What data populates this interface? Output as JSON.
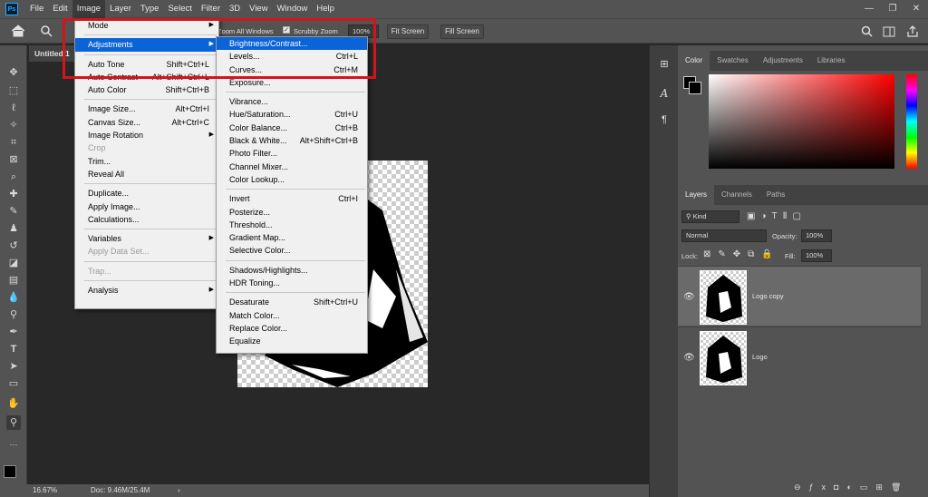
{
  "app": {
    "logo": "Ps"
  },
  "menubar": {
    "items": [
      "File",
      "Edit",
      "Image",
      "Layer",
      "Type",
      "Select",
      "Filter",
      "3D",
      "View",
      "Window",
      "Help"
    ]
  },
  "window_controls": {
    "minimize": "—",
    "restore": "❐",
    "close": "✕"
  },
  "options": {
    "zoom_all_windows": "Zoom All Windows",
    "scrubby_zoom": "Scrubby Zoom",
    "zoom_value": "100%",
    "fit_screen": "Fit Screen",
    "fill_screen": "Fill Screen"
  },
  "document": {
    "tab_title": "Untitled 1"
  },
  "status": {
    "zoom": "16.67%",
    "doc_size": "Doc: 9.46M/25.4M",
    "arrow": "›"
  },
  "image_menu": {
    "mode": "Mode",
    "adjustments": "Adjustments",
    "auto_tone": "Auto Tone",
    "auto_tone_sc": "Shift+Ctrl+L",
    "auto_contrast": "Auto Contrast",
    "auto_contrast_sc": "Alt+Shift+Ctrl+L",
    "auto_color": "Auto Color",
    "auto_color_sc": "Shift+Ctrl+B",
    "image_size": "Image Size...",
    "image_size_sc": "Alt+Ctrl+I",
    "canvas_size": "Canvas Size...",
    "canvas_size_sc": "Alt+Ctrl+C",
    "image_rotation": "Image Rotation",
    "crop": "Crop",
    "trim": "Trim...",
    "reveal_all": "Reveal All",
    "duplicate": "Duplicate...",
    "apply_image": "Apply Image...",
    "calculations": "Calculations...",
    "variables": "Variables",
    "apply_data_set": "Apply Data Set...",
    "trap": "Trap...",
    "analysis": "Analysis"
  },
  "adjustments_menu": {
    "brightness_contrast": "Brightness/Contrast...",
    "levels": "Levels...",
    "levels_sc": "Ctrl+L",
    "curves": "Curves...",
    "curves_sc": "Ctrl+M",
    "exposure": "Exposure...",
    "vibrance": "Vibrance...",
    "hue_saturation": "Hue/Saturation...",
    "hue_saturation_sc": "Ctrl+U",
    "color_balance": "Color Balance...",
    "color_balance_sc": "Ctrl+B",
    "black_white": "Black & White...",
    "black_white_sc": "Alt+Shift+Ctrl+B",
    "photo_filter": "Photo Filter...",
    "channel_mixer": "Channel Mixer...",
    "color_lookup": "Color Lookup...",
    "invert": "Invert",
    "invert_sc": "Ctrl+I",
    "posterize": "Posterize...",
    "threshold": "Threshold...",
    "gradient_map": "Gradient Map...",
    "selective_color": "Selective Color...",
    "shadows_highlights": "Shadows/Highlights...",
    "hdr_toning": "HDR Toning...",
    "desaturate": "Desaturate",
    "desaturate_sc": "Shift+Ctrl+U",
    "match_color": "Match Color...",
    "replace_color": "Replace Color...",
    "equalize": "Equalize"
  },
  "color_panel": {
    "tabs": [
      "Color",
      "Swatches",
      "Adjustments",
      "Libraries"
    ],
    "hue_color": "#ff0000"
  },
  "layers_panel": {
    "tabs": [
      "Layers",
      "Channels",
      "Paths"
    ],
    "filter_kind": "Kind",
    "blend_mode": "Normal",
    "opacity_label": "Opacity:",
    "opacity_value": "100%",
    "lock_label": "Lock:",
    "fill_label": "Fill:",
    "fill_value": "100%",
    "layers": [
      {
        "name": "Logo copy"
      },
      {
        "name": "Logo"
      }
    ]
  },
  "colors": {
    "highlight": "#0a64d7",
    "annotation_box": "#d4141c"
  }
}
